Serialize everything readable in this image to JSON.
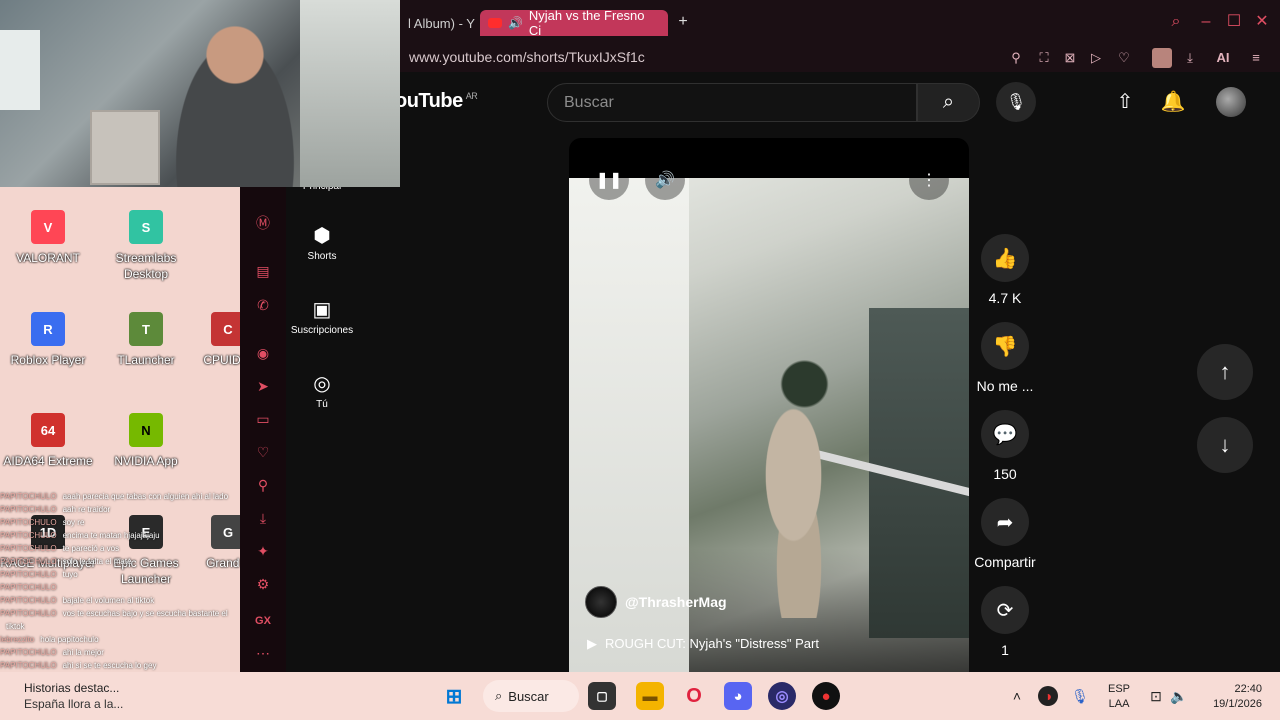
{
  "browser": {
    "tabs": [
      {
        "label": "l Album) - Y",
        "active": false
      },
      {
        "label": "Nyjah vs the Fresno Ci",
        "active": true
      }
    ],
    "url": "www.youtube.com/shorts/TkuxIJxSf1c",
    "ai_label": "AI"
  },
  "youtube": {
    "logo": "ouTube",
    "region": "AR",
    "search_placeholder": "Buscar",
    "nav": [
      {
        "label": "Principal",
        "icon": "home-icon"
      },
      {
        "label": "Shorts",
        "icon": "shorts-icon"
      },
      {
        "label": "Suscripciones",
        "icon": "subscriptions-icon"
      },
      {
        "label": "Tú",
        "icon": "you-icon"
      }
    ],
    "video": {
      "channel": "@ThrasherMag",
      "title": "ROUGH CUT: Nyjah's \"Distress\" Part"
    },
    "actions": {
      "like_count": "4.7 K",
      "dislike_label": "No me ...",
      "comments_count": "150",
      "share_label": "Compartir",
      "remix_count": "1"
    }
  },
  "desktop": {
    "icons": [
      {
        "label": "VALORANT",
        "color": "#ff4655"
      },
      {
        "label": "Streamlabs Desktop",
        "color": "#31c3a2"
      },
      {
        "label": "Roblox Player",
        "color": "#3a6df0"
      },
      {
        "label": "TLauncher",
        "color": "#5d8a3a"
      },
      {
        "label": "CPUID C",
        "color": "#c43434"
      },
      {
        "label": "AIDA64 Extreme",
        "color": "#d0312d"
      },
      {
        "label": "NVIDIA App",
        "color": "#76b900"
      },
      {
        "label": "RAGE Multiplayer",
        "color": "#222222"
      },
      {
        "label": "Epic Games Launcher",
        "color": "#2a2a2a"
      },
      {
        "label": "Grand T",
        "color": "#444444"
      }
    ]
  },
  "chat": [
    {
      "user": "PAPITOCHULO",
      "msg": "aaah parecia que tabas con alguien ahi al lado"
    },
    {
      "user": "PAPITOCHULO",
      "msg": "aah re traidor"
    },
    {
      "user": "PAPITOCHULO",
      "msg": "soy re"
    },
    {
      "user": "PAPITOCHULO",
      "msg": "encima te matan hjajajajaju"
    },
    {
      "user": "PAPITOCHULO",
      "msg": "te pareció a vos"
    },
    {
      "user": "PAPITOCHULO",
      "msg": "solo le falta el mate"
    },
    {
      "user": "PAPITOCHULO",
      "msg": "tuyo"
    },
    {
      "user": "PAPITOCHULO",
      "msg": ""
    },
    {
      "user": "PAPITOCHULO",
      "msg": "bajale el volumen al tiktok"
    },
    {
      "user": "PAPITOCHULO",
      "msg": "vos te escuchas bajo y se escucha bastante el"
    },
    {
      "user": "",
      "msg": "tiktok"
    },
    {
      "user": "lebrezzito",
      "msg": "hola papitochulo"
    },
    {
      "user": "PAPITOCHULO",
      "msg": "ahi la mejor"
    },
    {
      "user": "PAPITOCHULO",
      "msg": "ahi si se te escucha lo gey"
    }
  ],
  "taskbar": {
    "news_title": "Historias destac...",
    "news_sub": "España llora a la...",
    "search_label": "Buscar",
    "lang_top": "ESP",
    "lang_bottom": "LAA",
    "time": "22:40",
    "date": "19/1/2026"
  },
  "colors": {
    "accent": "#e04e63",
    "active_tab": "#c2375a",
    "yt_bg": "#0f0f0f",
    "taskbar_bg": "#f7dcd6"
  }
}
